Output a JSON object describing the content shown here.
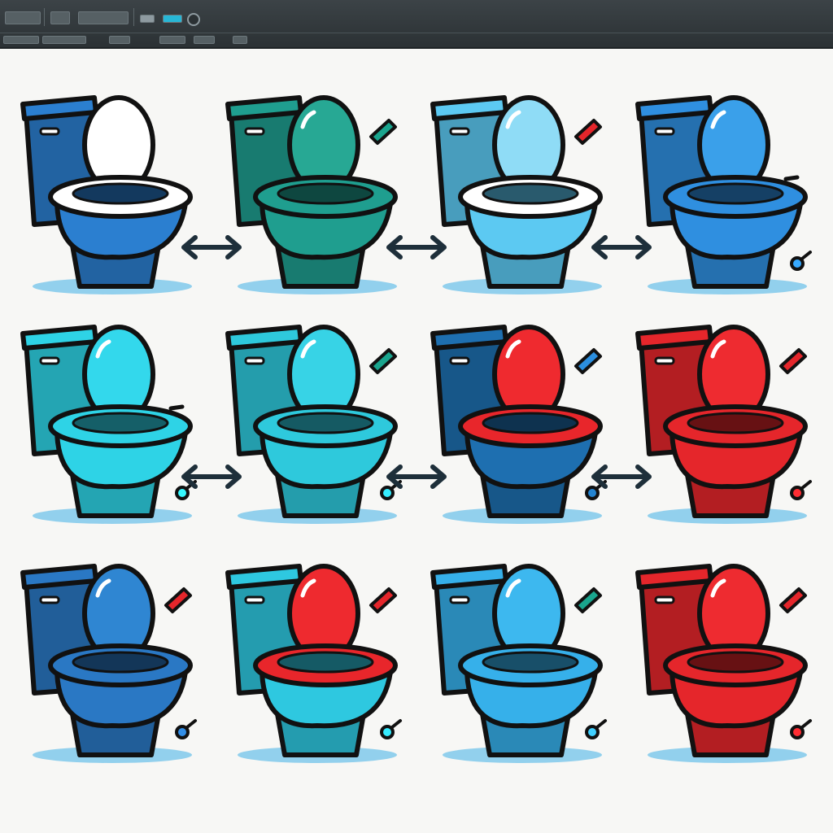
{
  "toolbar": {
    "buttons": [
      {
        "name": "file-menu-button",
        "label": ""
      },
      {
        "name": "edit-menu-button",
        "label": ""
      },
      {
        "name": "image-menu-button",
        "label": ""
      },
      {
        "name": "view-menu-button",
        "label": ""
      },
      {
        "name": "color-swatch-gray",
        "label": ""
      },
      {
        "name": "color-swatch-cyan",
        "label": ""
      },
      {
        "name": "zoom-icon-button",
        "label": ""
      }
    ],
    "row2_chips": [
      {
        "name": "tool-option-1",
        "label": ""
      },
      {
        "name": "tool-option-2",
        "label": ""
      },
      {
        "name": "tool-option-3",
        "label": ""
      },
      {
        "name": "tool-option-4",
        "label": ""
      },
      {
        "name": "tool-option-5",
        "label": ""
      },
      {
        "name": "tool-option-6",
        "label": ""
      }
    ]
  },
  "canvas": {
    "background_color": "#f7f7f5",
    "outline_color": "#111111",
    "arrow_color": "#1e2f3a",
    "grid": [
      [
        {
          "color": "#2b7fd0",
          "seat": "#ffffff",
          "lid": "#ffffff",
          "accent": "none"
        },
        {
          "color": "#1f9e8f",
          "seat": "#1f9e8f",
          "lid": "#27a894",
          "accent": "green"
        },
        {
          "color": "#5cc9f2",
          "seat": "#ffffff",
          "lid": "#8fdcf6",
          "accent": "red"
        },
        {
          "color": "#2f8fe0",
          "seat": "#2f8fe0",
          "lid": "#3aa0ea",
          "accent": "dash"
        }
      ],
      [
        {
          "color": "#2ed3e6",
          "seat": "#2ed3e6",
          "lid": "#33d8ec",
          "accent": "dash"
        },
        {
          "color": "#2ec9dc",
          "seat": "#2ec9dc",
          "lid": "#37d3e6",
          "accent": "green"
        },
        {
          "color": "#1e6fb0",
          "seat": "#e8262b",
          "lid": "#ef2a2f",
          "accent": "blue"
        },
        {
          "color": "#e5262b",
          "seat": "#e5262b",
          "lid": "#ee2b30",
          "accent": "red"
        }
      ],
      [
        {
          "color": "#2a78c4",
          "seat": "#2a78c4",
          "lid": "#2f86d2",
          "accent": "red"
        },
        {
          "color": "#2ec8e0",
          "seat": "#e8262b",
          "lid": "#ee2a2f",
          "accent": "red"
        },
        {
          "color": "#36b0ea",
          "seat": "#36b0ea",
          "lid": "#3db8ef",
          "accent": "green"
        },
        {
          "color": "#e5262b",
          "seat": "#e5262b",
          "lid": "#ee2b30",
          "accent": "red"
        }
      ]
    ],
    "arrows_between": [
      [
        true,
        true,
        true
      ],
      [
        true,
        true,
        true
      ],
      [
        false,
        false,
        false
      ]
    ]
  }
}
